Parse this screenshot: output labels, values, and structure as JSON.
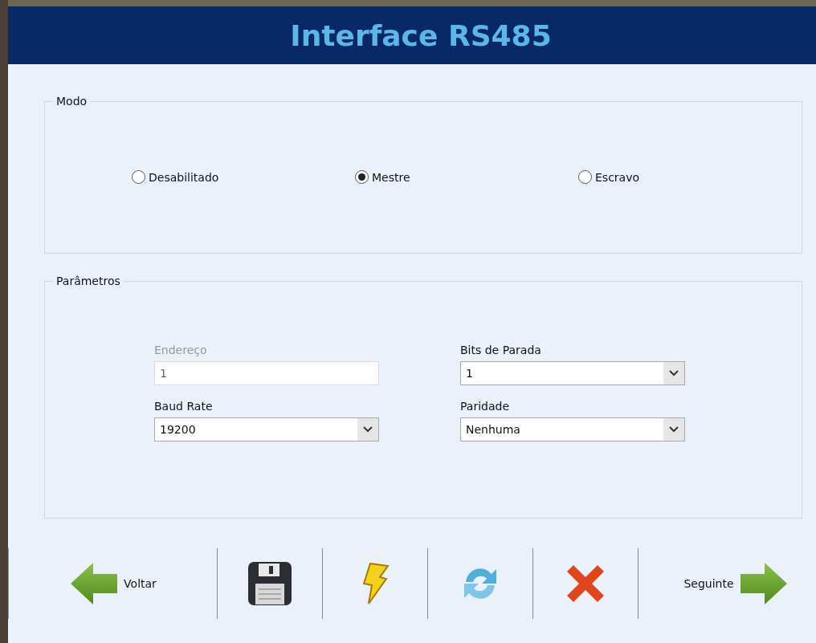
{
  "header": {
    "title": "Interface RS485"
  },
  "mode_group": {
    "legend": "Modo",
    "options": [
      {
        "label": "Desabilitado",
        "selected": false
      },
      {
        "label": "Mestre",
        "selected": true
      },
      {
        "label": "Escravo",
        "selected": false
      }
    ]
  },
  "params_group": {
    "legend": "Parâmetros",
    "fields": [
      {
        "kind": "text",
        "label": "Endereço",
        "value": "1",
        "disabled": true
      },
      {
        "kind": "select",
        "label": "Bits de Parada",
        "value": "1",
        "disabled": false
      },
      {
        "kind": "select",
        "label": "Baud Rate",
        "value": "19200",
        "disabled": false
      },
      {
        "kind": "select",
        "label": "Paridade",
        "value": "Nenhuma",
        "disabled": false
      }
    ]
  },
  "toolbar": [
    {
      "kind": "back",
      "label": "Voltar"
    },
    {
      "kind": "save"
    },
    {
      "kind": "flash"
    },
    {
      "kind": "refresh"
    },
    {
      "kind": "cancel"
    },
    {
      "kind": "next",
      "label": "Seguinte"
    }
  ]
}
